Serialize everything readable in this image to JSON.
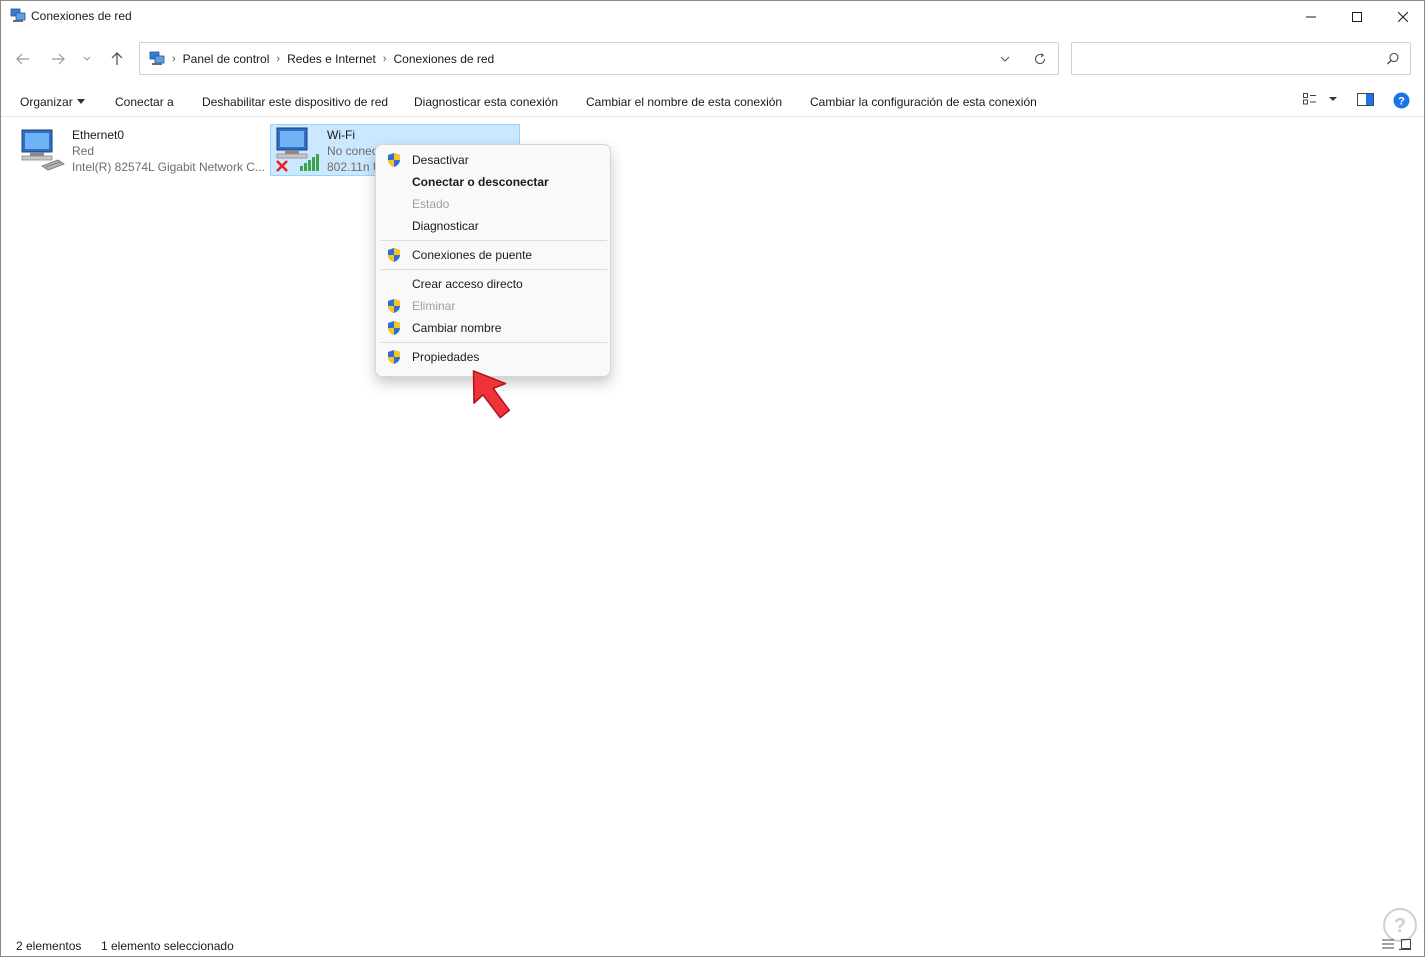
{
  "window": {
    "title": "Conexiones de red"
  },
  "address": {
    "crumbs": [
      "Panel de control",
      "Redes e Internet",
      "Conexiones de red"
    ],
    "search_placeholder": ""
  },
  "commands": {
    "organize": "Organizar",
    "connect": "Conectar a",
    "disable": "Deshabilitar este dispositivo de red",
    "diagnose": "Diagnosticar esta conexión",
    "rename": "Cambiar el nombre de esta conexión",
    "change_settings": "Cambiar la configuración de esta conexión"
  },
  "connections": [
    {
      "name": "Ethernet0",
      "status": "Red",
      "device": "Intel(R) 82574L Gigabit Network C..."
    },
    {
      "name": "Wi-Fi",
      "status": "No conec",
      "device": "802.11n U"
    }
  ],
  "context_menu": {
    "items": [
      {
        "label": "Desactivar",
        "shield": true,
        "bold": false,
        "disabled": false
      },
      {
        "label": "Conectar o desconectar",
        "shield": false,
        "bold": true,
        "disabled": false
      },
      {
        "label": "Estado",
        "shield": false,
        "bold": false,
        "disabled": true
      },
      {
        "label": "Diagnosticar",
        "shield": false,
        "bold": false,
        "disabled": false
      },
      {
        "label": "Conexiones de puente",
        "shield": true,
        "bold": false,
        "disabled": false
      },
      {
        "label": "Crear acceso directo",
        "shield": false,
        "bold": false,
        "disabled": false
      },
      {
        "label": "Eliminar",
        "shield": true,
        "bold": false,
        "disabled": true
      },
      {
        "label": "Cambiar nombre",
        "shield": true,
        "bold": false,
        "disabled": false
      },
      {
        "label": "Propiedades",
        "shield": true,
        "bold": false,
        "disabled": false
      }
    ]
  },
  "status": {
    "count": "2 elementos",
    "selected": "1 elemento seleccionado"
  },
  "colors": {
    "selection_bg": "#cce8ff",
    "selection_border": "#99d1ff",
    "help_blue": "#1a73e8",
    "cursor_red": "#f0333a"
  }
}
